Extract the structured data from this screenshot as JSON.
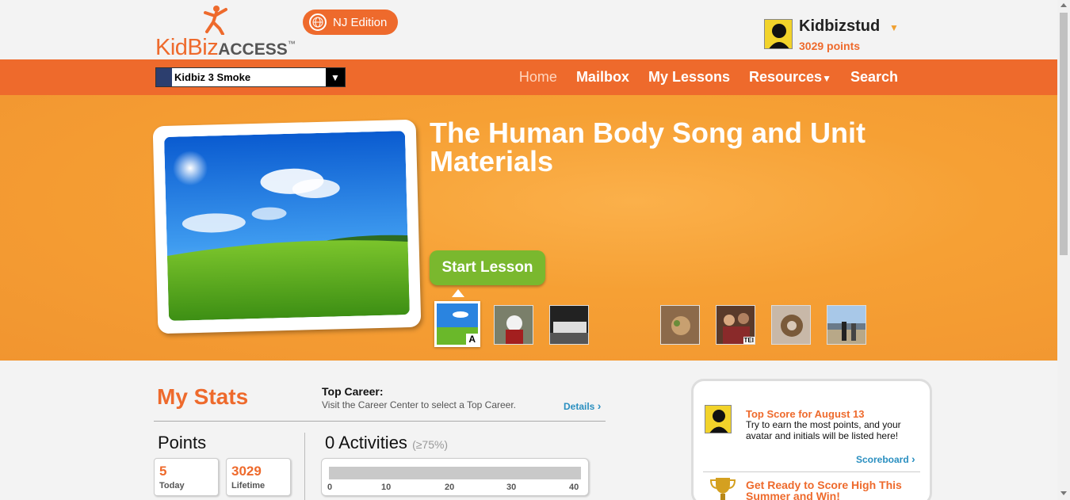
{
  "header": {
    "logo_kid": "KidBiz",
    "logo_access": "ACCESS",
    "logo_tm": "™",
    "edition": "NJ Edition",
    "user_name": "Kidbizstud",
    "user_points": "3029 points"
  },
  "nav": {
    "class_select_value": "Kidbiz 3 Smoke",
    "links": [
      "Home",
      "Mailbox",
      "My Lessons",
      "Resources",
      "Search"
    ]
  },
  "hero": {
    "title": "The Human Body Song and Unit Materials",
    "start_label": "Start Lesson",
    "thumb_badges": {
      "first": "A",
      "sixth": "TEI"
    }
  },
  "stats": {
    "title": "My Stats",
    "top_career_label": "Top Career:",
    "top_career_desc": "Visit the Career Center to select a Top Career.",
    "details": "Details",
    "points_label": "Points",
    "today_value": "5",
    "today_label": "Today",
    "lifetime_value": "3029",
    "lifetime_label": "Lifetime",
    "activities_label": "0 Activities",
    "activities_pct": "(≥75%)",
    "ticks": [
      "0",
      "10",
      "20",
      "30",
      "40"
    ],
    "activities_progress": 0
  },
  "side": {
    "top_score_head": "Top Score for August 13",
    "top_score_text": "Try to earn the most points, and your avatar and initials will be listed here!",
    "scoreboard": "Scoreboard",
    "summer_head": "Get Ready to Score High This Summer and Win!"
  },
  "colors": {
    "accent": "#ee6a2c",
    "hero": "#f6a034",
    "start": "#7ab82e",
    "link": "#2a8fc0"
  }
}
